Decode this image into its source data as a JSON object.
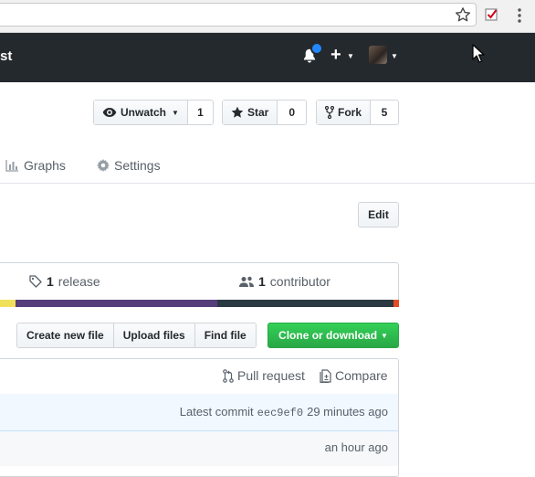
{
  "browser": {
    "bookmark_star_icon": "star-outline-icon",
    "extension_icon": "checklist-extension-icon",
    "menu_icon": "kebab-menu-icon"
  },
  "header": {
    "brand_fragment": "st",
    "notifications_icon": "bell-icon",
    "new_menu_label": "+",
    "avatar_icon": "user-avatar"
  },
  "repo_actions": {
    "watch": {
      "label": "Unwatch",
      "count": "1"
    },
    "star": {
      "label": "Star",
      "count": "0"
    },
    "fork": {
      "label": "Fork",
      "count": "5"
    }
  },
  "tabs": [
    {
      "label": "Graphs",
      "icon": "graph-icon"
    },
    {
      "label": "Settings",
      "icon": "gear-icon"
    }
  ],
  "edit_label": "Edit",
  "summary": {
    "releases_count": "1",
    "releases_label": "release",
    "contributors_count": "1",
    "contributors_label": "contributor"
  },
  "language_colors": [
    "#f1e05a",
    "#563d7c",
    "#2b3a42",
    "#e34c26"
  ],
  "file_nav": {
    "create_label": "Create new file",
    "upload_label": "Upload files",
    "find_label": "Find file",
    "clone_label": "Clone or download"
  },
  "file_header": {
    "pull_request_label": "Pull request",
    "compare_label": "Compare"
  },
  "commit": {
    "prefix": "Latest commit",
    "sha": "eec9ef0",
    "age": "29 minutes ago"
  },
  "file_row": {
    "age": "an hour ago"
  },
  "colors": {
    "header_bg": "#24292e",
    "accent_green": "#28a745",
    "notification_blue": "#2188ff"
  }
}
